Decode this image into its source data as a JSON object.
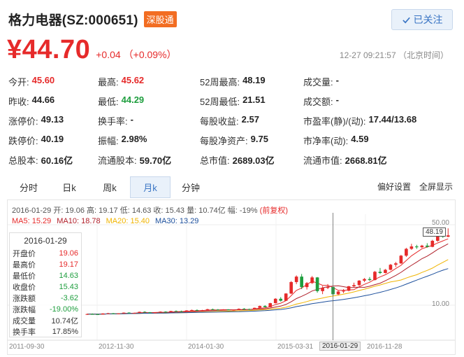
{
  "header": {
    "title": "格力电器(SZ:000651)",
    "badge": "深股通",
    "follow_label": "已关注"
  },
  "price": {
    "current": "¥44.70",
    "change": "+0.04",
    "change_pct": "（+0.09%）",
    "timestamp": "12-27 09:21:57 （北京时间）"
  },
  "quote": [
    [
      {
        "l": "今开:",
        "v": "45.60",
        "c": "up"
      },
      {
        "l": "最高:",
        "v": "45.62",
        "c": "up"
      },
      {
        "l": "52周最高:",
        "v": "48.19",
        "c": ""
      },
      {
        "l": "成交量:",
        "v": "-",
        "c": ""
      }
    ],
    [
      {
        "l": "昨收:",
        "v": "44.66",
        "c": ""
      },
      {
        "l": "最低:",
        "v": "44.29",
        "c": "down"
      },
      {
        "l": "52周最低:",
        "v": "21.51",
        "c": ""
      },
      {
        "l": "成交额:",
        "v": "-",
        "c": ""
      }
    ],
    [
      {
        "l": "涨停价:",
        "v": "49.13",
        "c": ""
      },
      {
        "l": "换手率:",
        "v": "-",
        "c": ""
      },
      {
        "l": "每股收益:",
        "v": "2.57",
        "c": ""
      },
      {
        "l": "市盈率(静)/(动):",
        "v": "17.44/13.68",
        "c": ""
      }
    ],
    [
      {
        "l": "跌停价:",
        "v": "40.19",
        "c": ""
      },
      {
        "l": "振幅:",
        "v": "2.98%",
        "c": ""
      },
      {
        "l": "每股净资产:",
        "v": "9.75",
        "c": ""
      },
      {
        "l": "市净率(动):",
        "v": "4.59",
        "c": ""
      }
    ],
    [
      {
        "l": "总股本:",
        "v": "60.16亿",
        "c": ""
      },
      {
        "l": "流通股本:",
        "v": "59.70亿",
        "c": ""
      },
      {
        "l": "总市值:",
        "v": "2689.03亿",
        "c": ""
      },
      {
        "l": "流通市值:",
        "v": "2668.81亿",
        "c": ""
      }
    ]
  ],
  "tabs": [
    "分时",
    "日k",
    "周k",
    "月k",
    "分钟"
  ],
  "active_tab": "月k",
  "tools": {
    "pref": "偏好设置",
    "fullscreen": "全屏显示"
  },
  "info_line": {
    "text": "2016-01-29 开: 19.06 高: 19.17 低: 14.63 收: 15.43 量: 10.74亿 幅: -19%",
    "adjust": "(前复权)"
  },
  "ma": [
    {
      "label": "MA5: 15.29",
      "color": "#e62a2a"
    },
    {
      "label": "MA10: 18.78",
      "color": "#b0202a"
    },
    {
      "label": "MA20: 15.40",
      "color": "#f0b400"
    },
    {
      "label": "MA30: 13.29",
      "color": "#1c4f9c"
    }
  ],
  "tooltip": {
    "date": "2016-01-29",
    "rows": [
      {
        "l": "开盘价",
        "v": "19.06",
        "c": "up"
      },
      {
        "l": "最高价",
        "v": "19.17",
        "c": "up"
      },
      {
        "l": "最低价",
        "v": "14.63",
        "c": "down"
      },
      {
        "l": "收盘价",
        "v": "15.43",
        "c": "down"
      },
      {
        "l": "涨跌额",
        "v": "-3.62",
        "c": "down"
      },
      {
        "l": "涨跌幅",
        "v": "-19.00%",
        "c": "down"
      },
      {
        "l": "成交量",
        "v": "10.74亿",
        "c": ""
      },
      {
        "l": "换手率",
        "v": "17.85%",
        "c": ""
      }
    ]
  },
  "colors": {
    "up": "#e62a2a",
    "down": "#1e9e3e",
    "accent": "#3a75c4"
  },
  "chart_data": {
    "type": "candlestick",
    "y_axis_labels": [
      "50.00",
      "10.00"
    ],
    "y_axis_values": [
      50,
      10
    ],
    "x_axis_labels": [
      "2011-09-30",
      "2012-11-30",
      "2014-01-30",
      "2015-03-31",
      "2016-01-29",
      "2016-11-28"
    ],
    "crosshair_label": "2016-01-29",
    "last_price_tag": "48.19",
    "candles": [
      [
        5.5,
        5.8,
        5.2,
        5.6
      ],
      [
        5.6,
        5.9,
        5.4,
        5.5
      ],
      [
        5.5,
        5.7,
        5.3,
        5.4
      ],
      [
        5.4,
        6.0,
        5.3,
        5.9
      ],
      [
        5.9,
        6.2,
        5.7,
        6.0
      ],
      [
        6.0,
        6.1,
        5.6,
        5.7
      ],
      [
        5.7,
        6.0,
        5.6,
        5.9
      ],
      [
        5.9,
        6.4,
        5.8,
        6.3
      ],
      [
        6.3,
        6.5,
        6.0,
        6.1
      ],
      [
        6.1,
        6.3,
        5.9,
        6.2
      ],
      [
        6.2,
        6.8,
        6.1,
        6.7
      ],
      [
        6.7,
        7.0,
        6.4,
        6.5
      ],
      [
        6.5,
        6.6,
        6.0,
        6.1
      ],
      [
        6.1,
        6.5,
        6.0,
        6.4
      ],
      [
        6.4,
        6.9,
        6.3,
        6.8
      ],
      [
        6.8,
        7.0,
        6.5,
        6.6
      ],
      [
        6.6,
        7.2,
        6.5,
        7.1
      ],
      [
        7.1,
        7.4,
        6.9,
        7.0
      ],
      [
        7.0,
        7.3,
        6.7,
        6.8
      ],
      [
        6.8,
        7.5,
        6.7,
        7.4
      ],
      [
        7.4,
        7.8,
        7.2,
        7.6
      ],
      [
        7.6,
        7.9,
        7.3,
        7.4
      ],
      [
        7.4,
        7.7,
        7.1,
        7.5
      ],
      [
        7.5,
        8.2,
        7.4,
        8.0
      ],
      [
        8.0,
        8.3,
        7.7,
        7.8
      ],
      [
        7.8,
        8.1,
        7.5,
        7.6
      ],
      [
        7.6,
        8.0,
        7.5,
        7.9
      ],
      [
        7.9,
        8.0,
        7.4,
        7.5
      ],
      [
        7.5,
        7.8,
        7.3,
        7.7
      ],
      [
        7.7,
        8.4,
        7.6,
        8.2
      ],
      [
        8.2,
        8.6,
        8.0,
        8.1
      ],
      [
        8.1,
        8.3,
        7.8,
        7.9
      ],
      [
        7.9,
        8.8,
        7.8,
        8.7
      ],
      [
        8.7,
        9.8,
        8.6,
        9.6
      ],
      [
        9.6,
        10.0,
        8.9,
        9.0
      ],
      [
        9.0,
        11.2,
        8.9,
        11.0
      ],
      [
        11.0,
        13.5,
        10.9,
        13.2
      ],
      [
        13.2,
        14.0,
        11.8,
        12.2
      ],
      [
        12.2,
        16.0,
        12.1,
        15.8
      ],
      [
        15.8,
        22.0,
        15.5,
        21.5
      ],
      [
        21.5,
        24.8,
        20.5,
        24.2
      ],
      [
        24.2,
        25.5,
        18.0,
        19.0
      ],
      [
        19.0,
        21.5,
        17.8,
        21.0
      ],
      [
        21.0,
        24.5,
        20.6,
        23.8
      ],
      [
        23.8,
        24.0,
        16.2,
        17.0
      ],
      [
        17.0,
        19.5,
        15.5,
        18.6
      ],
      [
        18.6,
        20.5,
        18.0,
        19.06
      ],
      [
        19.06,
        19.17,
        14.63,
        15.43
      ],
      [
        15.43,
        17.2,
        15.0,
        16.8
      ],
      [
        16.8,
        18.0,
        16.0,
        17.2
      ],
      [
        17.2,
        19.6,
        16.9,
        19.4
      ],
      [
        19.4,
        21.2,
        19.0,
        20.0
      ],
      [
        20.0,
        22.5,
        19.5,
        22.2
      ],
      [
        22.2,
        23.5,
        21.5,
        23.0
      ],
      [
        23.0,
        24.0,
        22.0,
        22.5
      ],
      [
        22.5,
        27.0,
        22.3,
        26.6
      ],
      [
        26.6,
        28.5,
        25.5,
        26.0
      ],
      [
        26.0,
        28.0,
        25.8,
        27.6
      ],
      [
        27.6,
        30.5,
        27.3,
        30.1
      ],
      [
        30.1,
        31.5,
        29.0,
        30.8
      ],
      [
        30.8,
        35.0,
        30.5,
        34.6
      ],
      [
        34.6,
        38.5,
        34.0,
        38.0
      ],
      [
        38.0,
        40.5,
        37.5,
        39.2
      ],
      [
        39.2,
        40.0,
        38.0,
        38.8
      ],
      [
        38.8,
        40.0,
        38.4,
        39.6
      ],
      [
        39.6,
        40.8,
        38.6,
        39.0
      ],
      [
        39.0,
        42.5,
        38.8,
        42.0
      ],
      [
        42.0,
        46.5,
        41.5,
        45.2
      ],
      [
        45.2,
        45.8,
        43.5,
        44.0
      ],
      [
        44.0,
        48.19,
        43.8,
        44.7
      ]
    ]
  }
}
